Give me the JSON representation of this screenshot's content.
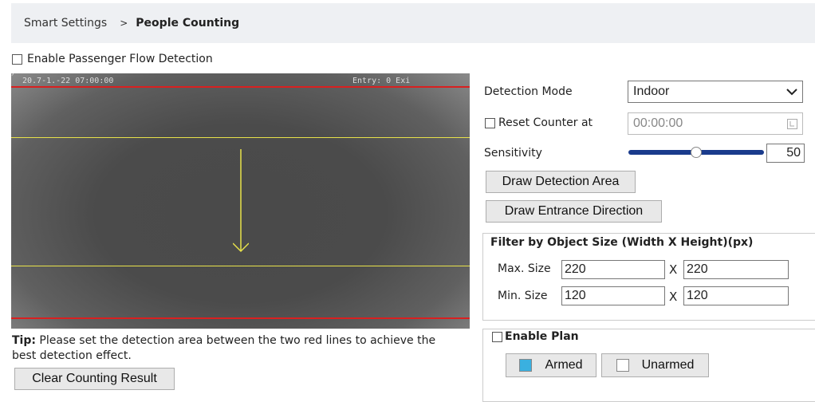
{
  "breadcrumb": {
    "parent": "Smart Settings",
    "separator": ">",
    "current": "People Counting"
  },
  "enable_passenger_flow": {
    "label": "Enable Passenger Flow Detection",
    "checked": false
  },
  "video": {
    "osd_time": "20.7-1.-22 07:00:00",
    "osd_count": "Entry:   0 Exi",
    "osd_corner": "y"
  },
  "tip": {
    "prefix": "Tip:",
    "text": " Please set the detection area between the two red lines to achieve the best detection effect."
  },
  "clear_button": "Clear Counting Result",
  "detection_mode": {
    "label": "Detection Mode",
    "value": "Indoor"
  },
  "reset_counter": {
    "label": "Reset Counter at",
    "value": "00:00:00",
    "checked": false
  },
  "sensitivity": {
    "label": "Sensitivity",
    "value": "50",
    "fraction": 0.5
  },
  "draw_area_button": "Draw Detection Area",
  "draw_direction_button": "Draw Entrance Direction",
  "filter": {
    "legend_bold": "Filter by Object Size",
    "legend_rest": " (Width X Height)(px)",
    "max_label": "Max. Size",
    "max_width": "220",
    "max_height": "220",
    "min_label": "Min. Size",
    "min_width": "120",
    "min_height": "120",
    "times": "X"
  },
  "plan": {
    "label": "Enable Plan",
    "armed": "Armed",
    "unarmed": "Unarmed",
    "armed_color": "#3ab0e0"
  },
  "colors": {
    "red_line": "#d92020",
    "detection_box": "#e8e24a",
    "slider_track": "#1a3b8c"
  }
}
